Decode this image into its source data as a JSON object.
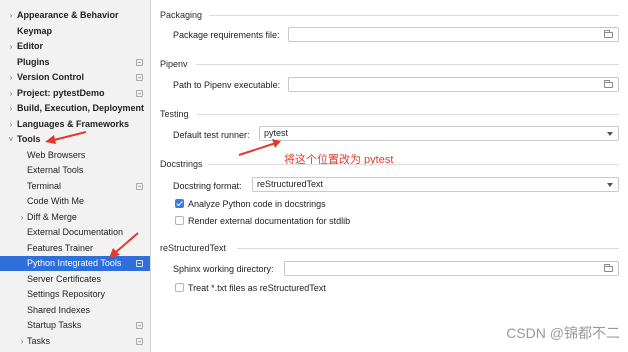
{
  "sidebar": {
    "items": [
      {
        "label": "Appearance & Behavior",
        "bold": true,
        "chevron": "right",
        "indent": 1,
        "badge": false,
        "selected": false
      },
      {
        "label": "Keymap",
        "bold": true,
        "chevron": "",
        "indent": 1,
        "badge": false,
        "selected": false
      },
      {
        "label": "Editor",
        "bold": true,
        "chevron": "right",
        "indent": 1,
        "badge": false,
        "selected": false
      },
      {
        "label": "Plugins",
        "bold": true,
        "chevron": "",
        "indent": 1,
        "badge": true,
        "selected": false
      },
      {
        "label": "Version Control",
        "bold": true,
        "chevron": "right",
        "indent": 1,
        "badge": true,
        "selected": false
      },
      {
        "label": "Project: pytestDemo",
        "bold": true,
        "chevron": "right",
        "indent": 1,
        "badge": true,
        "selected": false
      },
      {
        "label": "Build, Execution, Deployment",
        "bold": true,
        "chevron": "right",
        "indent": 1,
        "badge": false,
        "selected": false
      },
      {
        "label": "Languages & Frameworks",
        "bold": true,
        "chevron": "right",
        "indent": 1,
        "badge": false,
        "selected": false
      },
      {
        "label": "Tools",
        "bold": true,
        "chevron": "down",
        "indent": 1,
        "badge": false,
        "selected": false
      },
      {
        "label": "Web Browsers",
        "bold": false,
        "chevron": "",
        "indent": 2,
        "badge": false,
        "selected": false
      },
      {
        "label": "External Tools",
        "bold": false,
        "chevron": "",
        "indent": 2,
        "badge": false,
        "selected": false
      },
      {
        "label": "Terminal",
        "bold": false,
        "chevron": "",
        "indent": 2,
        "badge": true,
        "selected": false
      },
      {
        "label": "Code With Me",
        "bold": false,
        "chevron": "",
        "indent": 2,
        "badge": false,
        "selected": false
      },
      {
        "label": "Diff & Merge",
        "bold": false,
        "chevron": "right",
        "indent": 2,
        "badge": false,
        "selected": false
      },
      {
        "label": "External Documentation",
        "bold": false,
        "chevron": "",
        "indent": 2,
        "badge": false,
        "selected": false
      },
      {
        "label": "Features Trainer",
        "bold": false,
        "chevron": "",
        "indent": 2,
        "badge": false,
        "selected": false
      },
      {
        "label": "Python Integrated Tools",
        "bold": false,
        "chevron": "",
        "indent": 2,
        "badge": true,
        "selected": true
      },
      {
        "label": "Server Certificates",
        "bold": false,
        "chevron": "",
        "indent": 2,
        "badge": false,
        "selected": false
      },
      {
        "label": "Settings Repository",
        "bold": false,
        "chevron": "",
        "indent": 2,
        "badge": false,
        "selected": false
      },
      {
        "label": "Shared Indexes",
        "bold": false,
        "chevron": "",
        "indent": 2,
        "badge": false,
        "selected": false
      },
      {
        "label": "Startup Tasks",
        "bold": false,
        "chevron": "",
        "indent": 2,
        "badge": true,
        "selected": false
      },
      {
        "label": "Tasks",
        "bold": false,
        "chevron": "right",
        "indent": 2,
        "badge": true,
        "selected": false
      }
    ]
  },
  "sections": {
    "packaging": {
      "title": "Packaging",
      "requirements_label": "Package requirements file:",
      "requirements_value": ""
    },
    "pipenv": {
      "title": "Pipenv",
      "path_label": "Path to Pipenv executable:",
      "path_value": ""
    },
    "testing": {
      "title": "Testing",
      "runner_label": "Default test runner:",
      "runner_value": "pytest"
    },
    "docstrings": {
      "title": "Docstrings",
      "format_label": "Docstring format:",
      "format_value": "reStructuredText",
      "analyze_label": "Analyze Python code in docstrings",
      "analyze_checked": true,
      "render_label": "Render external documentation for stdlib",
      "render_checked": false
    },
    "restructured": {
      "title": "reStructuredText",
      "sphinx_label": "Sphinx working directory:",
      "sphinx_value": "",
      "treat_label": "Treat *.txt files as reStructuredText",
      "treat_checked": false
    }
  },
  "annotation": {
    "text": "将这个位置改为 pytest",
    "color": "#e33a2d"
  },
  "watermark": {
    "text": "CSDN @锦都不二"
  },
  "colors": {
    "accent": "#2f6fd9",
    "annotation": "#e33a2d",
    "checkbox": "#3b7de4"
  }
}
